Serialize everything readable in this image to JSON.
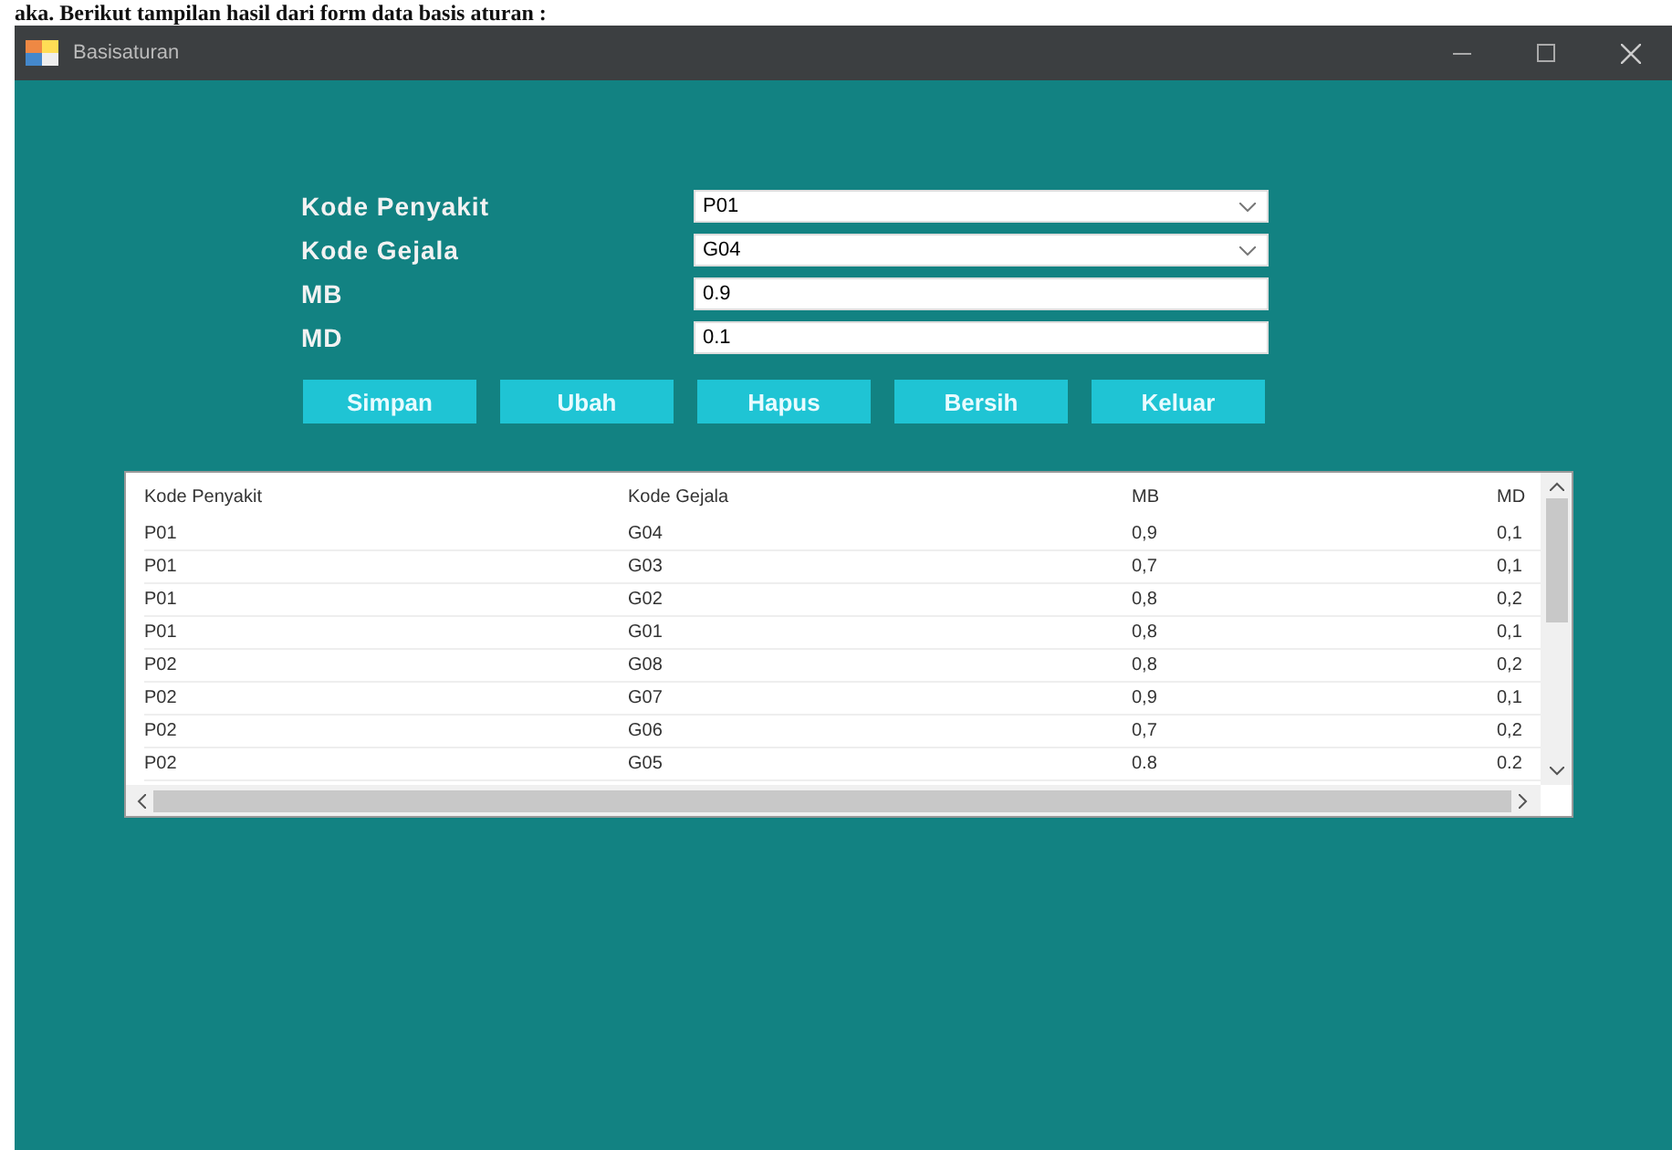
{
  "caption": "aka. Berikut tampilan hasil dari form data basis aturan :",
  "window": {
    "title": "Basisaturan"
  },
  "fields": [
    {
      "kind": "combo",
      "label": "Kode Penyakit",
      "value": "P01"
    },
    {
      "kind": "combo",
      "label": "Kode Gejala",
      "value": "G04"
    },
    {
      "kind": "text",
      "label": "MB",
      "value": "0.9"
    },
    {
      "kind": "text",
      "label": "MD",
      "value": "0.1"
    }
  ],
  "buttons": [
    "Simpan",
    "Ubah",
    "Hapus",
    "Bersih",
    "Keluar"
  ],
  "table": {
    "columns": [
      "Kode Penyakit",
      "Kode Gejala",
      "MB",
      "MD"
    ],
    "rows": [
      [
        "P01",
        "G04",
        "0,9",
        "0,1"
      ],
      [
        "P01",
        "G03",
        "0,7",
        "0,1"
      ],
      [
        "P01",
        "G02",
        "0,8",
        "0,2"
      ],
      [
        "P01",
        "G01",
        "0,8",
        "0,1"
      ],
      [
        "P02",
        "G08",
        "0,8",
        "0,2"
      ],
      [
        "P02",
        "G07",
        "0,9",
        "0,1"
      ],
      [
        "P02",
        "G06",
        "0,7",
        "0,2"
      ],
      [
        "P02",
        "G05",
        "0.8",
        "0.2"
      ]
    ]
  }
}
